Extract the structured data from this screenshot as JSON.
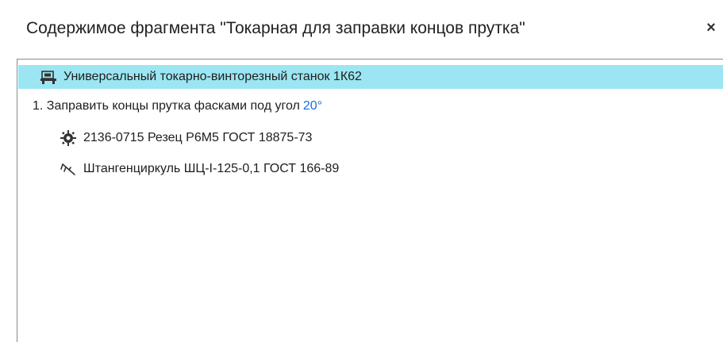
{
  "dialog": {
    "title": "Содержимое фрагмента \"Токарная для заправки концов прутка\"",
    "close_label": "×"
  },
  "tree": {
    "machine": {
      "icon": "lathe-machine-icon",
      "label": "Универсальный токарно-винторезный станок 1К62"
    },
    "operation": {
      "label": "1. Заправить концы прутка фасками под угол",
      "angle": "20°"
    },
    "tools": [
      {
        "icon": "cutter-gear-icon",
        "label": "2136-0715 Резец Р6М5 ГОСТ 18875-73"
      },
      {
        "icon": "caliper-icon",
        "label": "Штангенциркуль ШЦ-I-125-0,1 ГОСТ 166-89"
      }
    ]
  },
  "colors": {
    "selection": "#9be6f2",
    "angle_accent": "#1a6fe0",
    "panel_border": "#8a8a8a"
  }
}
